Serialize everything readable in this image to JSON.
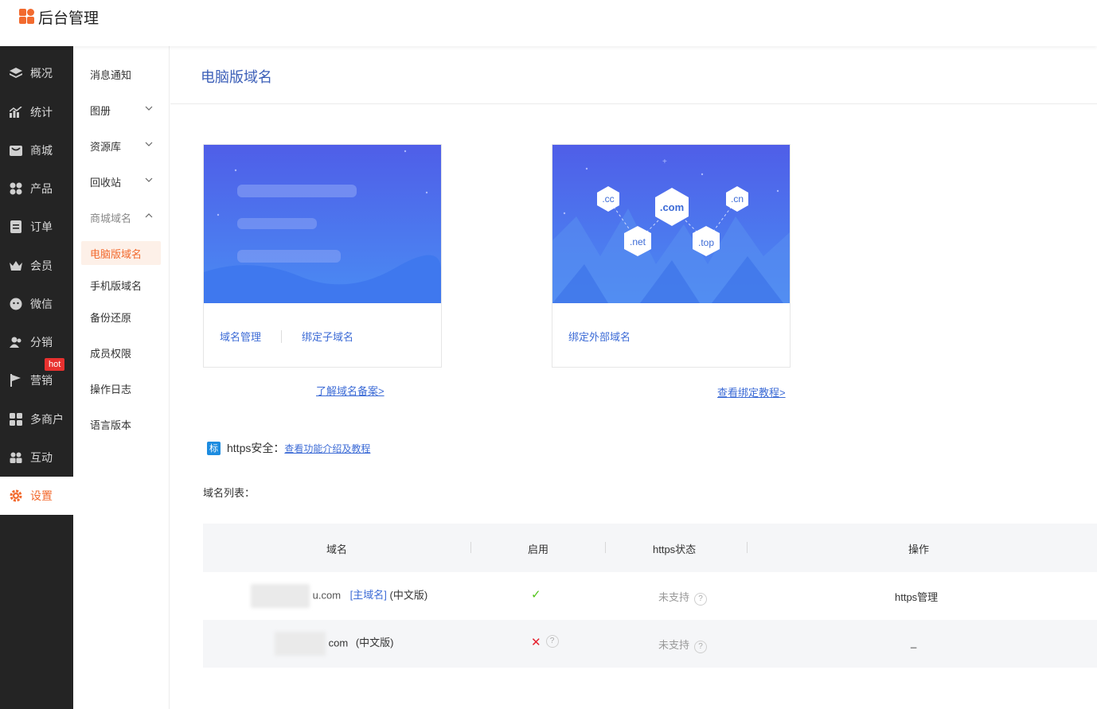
{
  "app": {
    "title": "后台管理"
  },
  "sidebar": {
    "items": [
      {
        "label": "概况",
        "icon": "layers-icon"
      },
      {
        "label": "统计",
        "icon": "chart-icon"
      },
      {
        "label": "商城",
        "icon": "store-icon"
      },
      {
        "label": "产品",
        "icon": "grid-icon"
      },
      {
        "label": "订单",
        "icon": "order-icon"
      },
      {
        "label": "会员",
        "icon": "crown-icon"
      },
      {
        "label": "微信",
        "icon": "wechat-icon"
      },
      {
        "label": "分销",
        "icon": "users-icon"
      },
      {
        "label": "营销",
        "icon": "flag-icon"
      },
      {
        "label": "多商户",
        "icon": "shop-icon"
      },
      {
        "label": "互动",
        "icon": "people-icon"
      },
      {
        "label": "设置",
        "icon": "gear-icon",
        "active": true
      }
    ],
    "hot_badge": "hot"
  },
  "subnav": {
    "items": [
      {
        "label": "消息通知"
      },
      {
        "label": "图册"
      },
      {
        "label": "资源库"
      },
      {
        "label": "回收站"
      },
      {
        "label": "商城域名"
      },
      {
        "label": "电脑版域名"
      },
      {
        "label": "手机版域名"
      },
      {
        "label": "备份还原"
      },
      {
        "label": "成员权限"
      },
      {
        "label": "操作日志"
      },
      {
        "label": "语言版本"
      }
    ]
  },
  "main": {
    "page_title": "电脑版域名",
    "card1": {
      "link1": "域名管理",
      "link2": "绑定子域名",
      "below_link": "了解域名备案>"
    },
    "card2": {
      "link1": "绑定外部域名",
      "below_link": "查看绑定教程>",
      "tlds": [
        ".cc",
        ".com",
        ".cn",
        ".net",
        ".top"
      ]
    },
    "https": {
      "tag": "标",
      "label": "https安全：",
      "link": "查看功能介绍及教程"
    },
    "list_label": "域名列表：",
    "table": {
      "headers": [
        "域名",
        "启用",
        "https状态",
        "操作"
      ],
      "rows": [
        {
          "domain_suffix": "u.com",
          "main_tag": "[主域名]",
          "version": "(中文版)",
          "enabled": "✓",
          "https_status": "未支持",
          "action": "https管理"
        },
        {
          "domain_suffix": "com",
          "version": "(中文版)",
          "enabled": "✕",
          "https_status": "未支持",
          "action": "_"
        }
      ]
    }
  },
  "colors": {
    "accent": "#f26a2e",
    "link": "#3c6bd6",
    "sidebar_bg": "#242424",
    "check": "#52c41a",
    "cross": "#e5202e"
  }
}
